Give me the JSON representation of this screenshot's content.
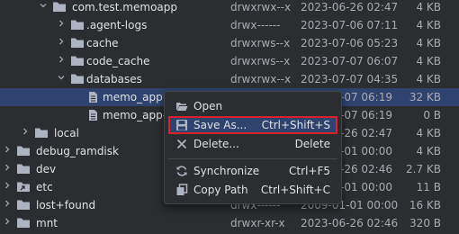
{
  "tree": {
    "rows": [
      {
        "name": "com.test.memoapp",
        "perm": "drwxrwx--x",
        "date": "2023-06-26 02:47",
        "size": "4 KB",
        "kind": "folder",
        "expanded": true
      },
      {
        "name": ".agent-logs",
        "perm": "drwx------",
        "date": "2023-07-06 07:11",
        "size": "4 KB",
        "kind": "folder",
        "expanded": false
      },
      {
        "name": "cache",
        "perm": "drwxrws--x",
        "date": "2023-07-06 05:23",
        "size": "4 KB",
        "kind": "folder",
        "expanded": false
      },
      {
        "name": "code_cache",
        "perm": "drwxrws--x",
        "date": "2023-07-07 06:07",
        "size": "4 KB",
        "kind": "folder",
        "expanded": false
      },
      {
        "name": "databases",
        "perm": "drwxrwx--x",
        "date": "2023-07-07 04:35",
        "size": "4 KB",
        "kind": "folder",
        "expanded": true
      },
      {
        "name": "memo_app",
        "perm": "",
        "date": "-07 06:19",
        "size": "32 KB",
        "kind": "file",
        "selected": true
      },
      {
        "name": "memo_app-j",
        "perm": "",
        "date": "-07 06:19",
        "size": "0 B",
        "kind": "file"
      },
      {
        "name": "local",
        "perm": "",
        "date": "-26 02:47",
        "size": "4 KB",
        "kind": "folder",
        "expanded": false
      },
      {
        "name": "debug_ramdisk",
        "perm": "",
        "date": "-01 00:00",
        "size": "4 KB",
        "kind": "folder",
        "expanded": false
      },
      {
        "name": "dev",
        "perm": "",
        "date": "-26 02:46",
        "size": "2.7 KB",
        "kind": "folder",
        "expanded": false
      },
      {
        "name": "etc",
        "perm": "",
        "date": "-01 00:00",
        "size": "11 B",
        "kind": "link",
        "expanded": false
      },
      {
        "name": "lost+found",
        "perm": "drwx------",
        "date": "2009-01-01 00:00",
        "size": "16 KB",
        "kind": "folder",
        "expanded": false
      },
      {
        "name": "mnt",
        "perm": "drwxr-xr-x",
        "date": "2023-06-26 02:46",
        "size": "320 B",
        "kind": "folder",
        "expanded": false
      }
    ]
  },
  "context_menu": {
    "items": [
      {
        "label": "Open",
        "shortcut": "",
        "icon": "open-folder-icon"
      },
      {
        "label": "Save As...",
        "shortcut": "Ctrl+Shift+S",
        "icon": "save-icon",
        "highlighted": true
      },
      {
        "label": "Delete...",
        "shortcut": "Delete",
        "icon": "delete-x-icon"
      },
      {
        "label": "Synchronize",
        "shortcut": "Ctrl+F5",
        "icon": "sync-icon"
      },
      {
        "label": "Copy Path",
        "shortcut": "Ctrl+Shift+C",
        "icon": "copy-icon"
      }
    ]
  },
  "colors": {
    "background": "#2b2d30",
    "selection": "#2e436e",
    "highlight_outline": "#d8222a",
    "folder_icon": "#aeb3c2",
    "text": "#dfe1e5",
    "muted_text": "#a9abb1"
  }
}
